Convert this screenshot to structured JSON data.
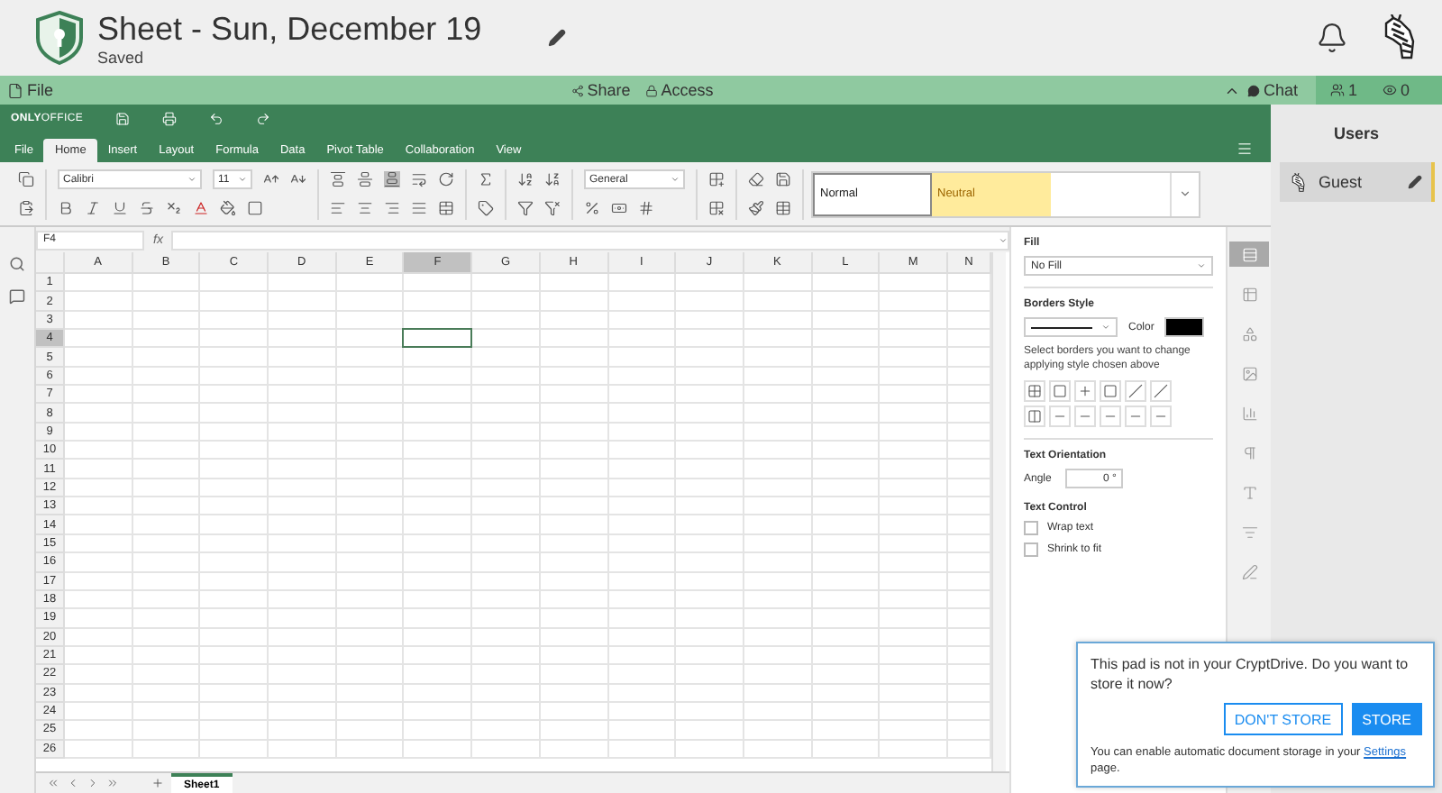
{
  "header": {
    "title": "Sheet - Sun, December 19",
    "status": "Saved"
  },
  "topbar": {
    "file": "File",
    "share": "Share",
    "access": "Access",
    "chat": "Chat",
    "users_count": "1",
    "viewers_count": "0"
  },
  "editor": {
    "brand": "**ONLY**OFFICE",
    "tabs": [
      {
        "label": "File",
        "selected": false
      },
      {
        "label": "Home",
        "selected": true
      },
      {
        "label": "Insert",
        "selected": false
      },
      {
        "label": "Layout",
        "selected": false
      },
      {
        "label": "Formula",
        "selected": false
      },
      {
        "label": "Data",
        "selected": false
      },
      {
        "label": "Pivot Table",
        "selected": false
      },
      {
        "label": "Collaboration",
        "selected": false
      },
      {
        "label": "View",
        "selected": false
      }
    ],
    "toolbar": {
      "font": "Calibri",
      "size": "11",
      "number_format": "General",
      "styles": [
        {
          "label": "Normal",
          "kind": "normal"
        },
        {
          "label": "Neutral",
          "kind": "neutral"
        }
      ]
    },
    "formula_bar": {
      "cell": "F4",
      "fx": "fx"
    },
    "sheet": {
      "columns": [
        {
          "label": "A",
          "selected": false
        },
        {
          "label": "B",
          "selected": false
        },
        {
          "label": "C",
          "selected": false
        },
        {
          "label": "D",
          "selected": false
        },
        {
          "label": "E",
          "selected": false
        },
        {
          "label": "F",
          "selected": true
        },
        {
          "label": "G",
          "selected": false
        },
        {
          "label": "H",
          "selected": false
        },
        {
          "label": "I",
          "selected": false
        },
        {
          "label": "J",
          "selected": false
        },
        {
          "label": "K",
          "selected": false
        },
        {
          "label": "L",
          "selected": false
        },
        {
          "label": "M",
          "selected": false
        },
        {
          "label": "N",
          "selected": false
        }
      ],
      "rows": [
        {
          "label": "1",
          "selected": false
        },
        {
          "label": "2",
          "selected": false
        },
        {
          "label": "3",
          "selected": false
        },
        {
          "label": "4",
          "selected": true
        },
        {
          "label": "5",
          "selected": false
        },
        {
          "label": "6",
          "selected": false
        },
        {
          "label": "7",
          "selected": false
        },
        {
          "label": "8",
          "selected": false
        },
        {
          "label": "9",
          "selected": false
        },
        {
          "label": "10",
          "selected": false
        },
        {
          "label": "11",
          "selected": false
        },
        {
          "label": "12",
          "selected": false
        },
        {
          "label": "13",
          "selected": false
        },
        {
          "label": "14",
          "selected": false
        },
        {
          "label": "15",
          "selected": false
        },
        {
          "label": "16",
          "selected": false
        },
        {
          "label": "17",
          "selected": false
        },
        {
          "label": "18",
          "selected": false
        },
        {
          "label": "19",
          "selected": false
        },
        {
          "label": "20",
          "selected": false
        },
        {
          "label": "21",
          "selected": false
        },
        {
          "label": "22",
          "selected": false
        },
        {
          "label": "23",
          "selected": false
        },
        {
          "label": "24",
          "selected": false
        },
        {
          "label": "25",
          "selected": false
        },
        {
          "label": "26",
          "selected": false
        }
      ],
      "sheet_tabs": [
        {
          "label": "Sheet1",
          "selected": true
        }
      ]
    },
    "settings": {
      "fill_label": "Fill",
      "fill_value": "No Fill",
      "borders_title": "Borders Style",
      "color_label": "Color",
      "borders_hint": "Select borders you want to change applying style chosen above",
      "orientation_title": "Text Orientation",
      "angle_label": "Angle",
      "angle_value": "0 °",
      "control_title": "Text Control",
      "checkboxes": [
        {
          "label": "Wrap text",
          "checked": false
        },
        {
          "label": "Shrink to fit",
          "checked": false
        }
      ]
    },
    "settings_tabs": [
      {
        "selected": true
      },
      {
        "selected": false
      },
      {
        "selected": false
      },
      {
        "selected": false
      },
      {
        "selected": false
      },
      {
        "selected": false
      },
      {
        "selected": false
      },
      {
        "selected": false
      },
      {
        "selected": false
      }
    ]
  },
  "users_panel": {
    "title": "Users",
    "users": [
      {
        "name": "Guest"
      }
    ]
  },
  "popup": {
    "message": "This pad is not in your CryptDrive. Do you want to store it now?",
    "buttons": [
      {
        "label": "DON'T STORE",
        "kind": "secondary"
      },
      {
        "label": "STORE",
        "kind": "primary"
      }
    ],
    "note": "You can enable automatic document storage in your",
    "link": "Settings",
    "note_end": "page."
  }
}
